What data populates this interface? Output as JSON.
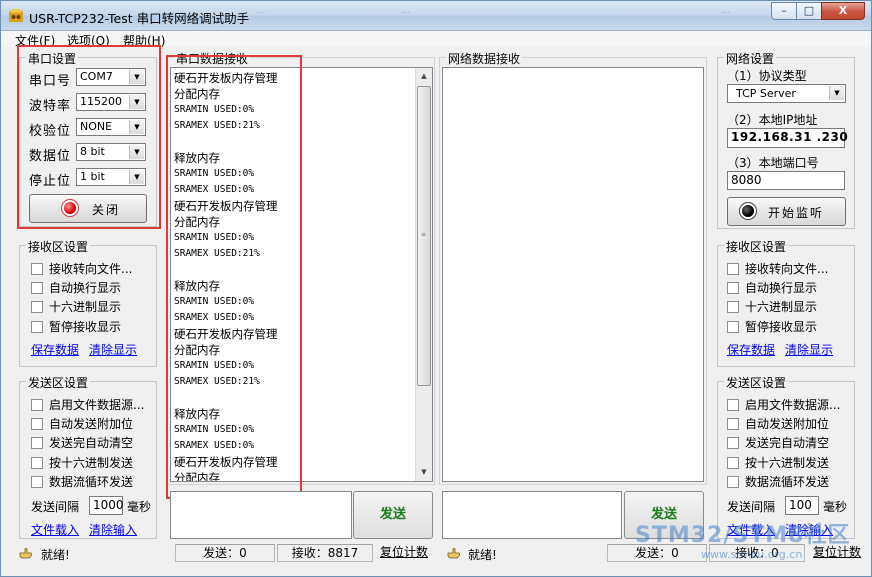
{
  "window": {
    "title": "USR-TCP232-Test 串口转网络调试助手",
    "background_title_fragments": [
      "...",
      "...",
      "..."
    ],
    "buttons": {
      "minimize": "–",
      "maximize": "□",
      "close": "X"
    }
  },
  "menu": [
    "文件(F)",
    "选项(O)",
    "帮助(H)"
  ],
  "serial_settings": {
    "title": "串口设置",
    "port_label": "串口号",
    "port_value": "COM7",
    "baud_label": "波特率",
    "baud_value": "115200",
    "parity_label": "校验位",
    "parity_value": "NONE",
    "databits_label": "数据位",
    "databits_value": "8 bit",
    "stopbits_label": "停止位",
    "stopbits_value": "1 bit",
    "toggle_button": "关闭",
    "led_color": "#e01010"
  },
  "left_receive": {
    "title": "接收区设置",
    "options": [
      "接收转向文件...",
      "自动换行显示",
      "十六进制显示",
      "暂停接收显示"
    ],
    "save_link": "保存数据",
    "clear_link": "清除显示"
  },
  "left_send": {
    "title": "发送区设置",
    "options": [
      "启用文件数据源...",
      "自动发送附加位",
      "发送完自动清空",
      "按十六进制发送",
      "数据流循环发送"
    ],
    "interval_label": "发送间隔",
    "interval_value": "1000",
    "interval_unit": "毫秒",
    "load_link": "文件载入",
    "clear_link": "清除输入"
  },
  "serial_receive": {
    "title": "串口数据接收",
    "lines": [
      {
        "text": "硬石开发板内存管理",
        "mono": false
      },
      {
        "text": "分配内存",
        "mono": false
      },
      {
        "text": "SRAMIN USED:0%",
        "mono": true
      },
      {
        "text": "SRAMEX USED:21%",
        "mono": true
      },
      {
        "text": "",
        "mono": false
      },
      {
        "text": "释放内存",
        "mono": false
      },
      {
        "text": "SRAMIN USED:0%",
        "mono": true
      },
      {
        "text": "SRAMEX USED:0%",
        "mono": true
      },
      {
        "text": "硬石开发板内存管理",
        "mono": false
      },
      {
        "text": "分配内存",
        "mono": false
      },
      {
        "text": "SRAMIN USED:0%",
        "mono": true
      },
      {
        "text": "SRAMEX USED:21%",
        "mono": true
      },
      {
        "text": "",
        "mono": false
      },
      {
        "text": "释放内存",
        "mono": false
      },
      {
        "text": "SRAMIN USED:0%",
        "mono": true
      },
      {
        "text": "SRAMEX USED:0%",
        "mono": true
      },
      {
        "text": "硬石开发板内存管理",
        "mono": false
      },
      {
        "text": "分配内存",
        "mono": false
      },
      {
        "text": "SRAMIN USED:0%",
        "mono": true
      },
      {
        "text": "SRAMEX USED:21%",
        "mono": true
      },
      {
        "text": "",
        "mono": false
      },
      {
        "text": "释放内存",
        "mono": false
      },
      {
        "text": "SRAMIN USED:0%",
        "mono": true
      },
      {
        "text": "SRAMEX USED:0%",
        "mono": true
      },
      {
        "text": "硬石开发板内存管理",
        "mono": false
      },
      {
        "text": "分配内存",
        "mono": false
      }
    ]
  },
  "network_receive": {
    "title": "网络数据接收"
  },
  "network_settings": {
    "title": "网络设置",
    "protocol_label": "（1）协议类型",
    "protocol_value": "TCP Server",
    "ip_label": "（2）本地IP地址",
    "ip_value": "192.168.31 .230",
    "port_label": "（3）本地端口号",
    "port_value": "8080",
    "listen_button": "开始监听"
  },
  "right_receive": {
    "title": "接收区设置",
    "options": [
      "接收转向文件...",
      "自动换行显示",
      "十六进制显示",
      "暂停接收显示"
    ],
    "save_link": "保存数据",
    "clear_link": "清除显示"
  },
  "right_send": {
    "title": "发送区设置",
    "options": [
      "启用文件数据源...",
      "自动发送附加位",
      "发送完自动清空",
      "按十六进制发送",
      "数据流循环发送"
    ],
    "interval_label": "发送间隔",
    "interval_value": "100",
    "interval_unit": "毫秒",
    "load_link": "文件载入",
    "clear_link": "清除输入"
  },
  "send_button": "发送",
  "status_left": {
    "ready": "就绪!",
    "sent": "发送：0",
    "received": "接收：8817",
    "reset": "复位计数"
  },
  "status_right": {
    "ready": "就绪!",
    "sent": "发送：0",
    "received": "接收：0",
    "reset": "复位计数"
  },
  "watermark": {
    "main": "STM32/STM8社区",
    "sub": "www.stmcu.org.cn"
  },
  "colors": {
    "highlight_box": "#e03a3a",
    "send_text": "#1a7a1a",
    "link": "#0000ee"
  }
}
